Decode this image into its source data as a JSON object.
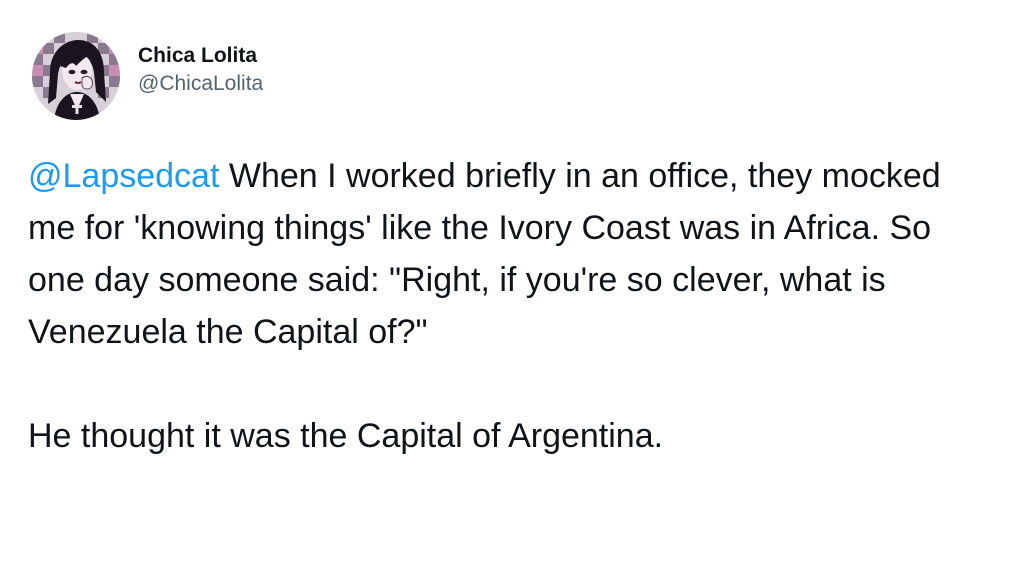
{
  "author": {
    "display_name": "Chica Lolita",
    "handle": "@ChicaLolita",
    "avatar_icon": "profile-avatar-illustration"
  },
  "tweet": {
    "mention": "@Lapsedcat",
    "paragraph1_text": " When I worked briefly in an office, they mocked me for 'knowing things' like the Ivory Coast was in Africa. So one day someone said: \"Right, if you're so clever, what is Venezuela the Capital of?\"",
    "paragraph2_text": "He thought it was the Capital of Argentina."
  },
  "colors": {
    "text": "#0f1419",
    "secondary_text": "#536471",
    "link": "#1d9bf0",
    "background": "#ffffff"
  }
}
